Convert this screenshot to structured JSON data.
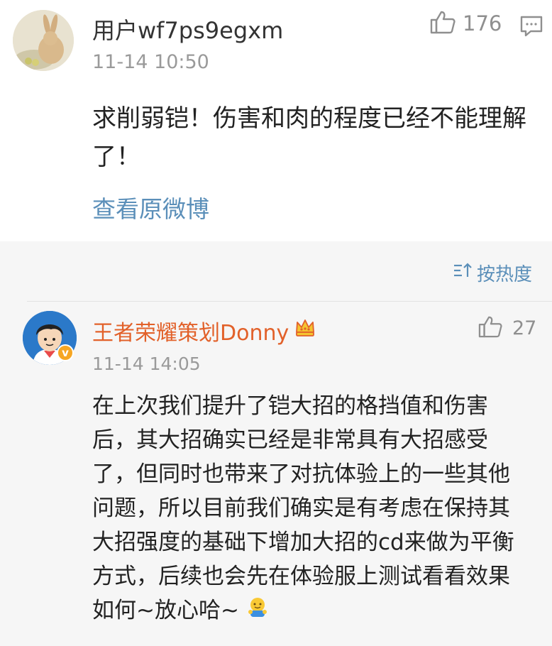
{
  "top_comment": {
    "username": "用户wf7ps9egxm",
    "timestamp": "11-14 10:50",
    "like_count": "176",
    "content": "求削弱铠！伤害和肉的程度已经不能理解了！",
    "view_original": "查看原微博"
  },
  "sort": {
    "label": "按热度"
  },
  "reply": {
    "username": "王者荣耀策划Donny",
    "timestamp": "11-14 14:05",
    "like_count": "27",
    "content": "在上次我们提升了铠大招的格挡值和伤害后，其大招确实已经是非常具有大招感受了，但同时也带来了对抗体验上的一些其他问题，所以目前我们确实是有考虑在保持其大招强度的基础下增加大招的cd来做为平衡方式，后续也会先在体验服上测试看看效果如何~放心哈~",
    "verified_badge": "v"
  },
  "colors": {
    "link": "#5b8fb9",
    "official_name": "#e2612a",
    "muted": "#9a9a9a",
    "reply_bg": "#f6f6f6"
  },
  "icons": [
    "thumbs-up-icon",
    "reply-comment-icon",
    "sort-icon",
    "crown-icon",
    "hug-emoji-icon"
  ]
}
